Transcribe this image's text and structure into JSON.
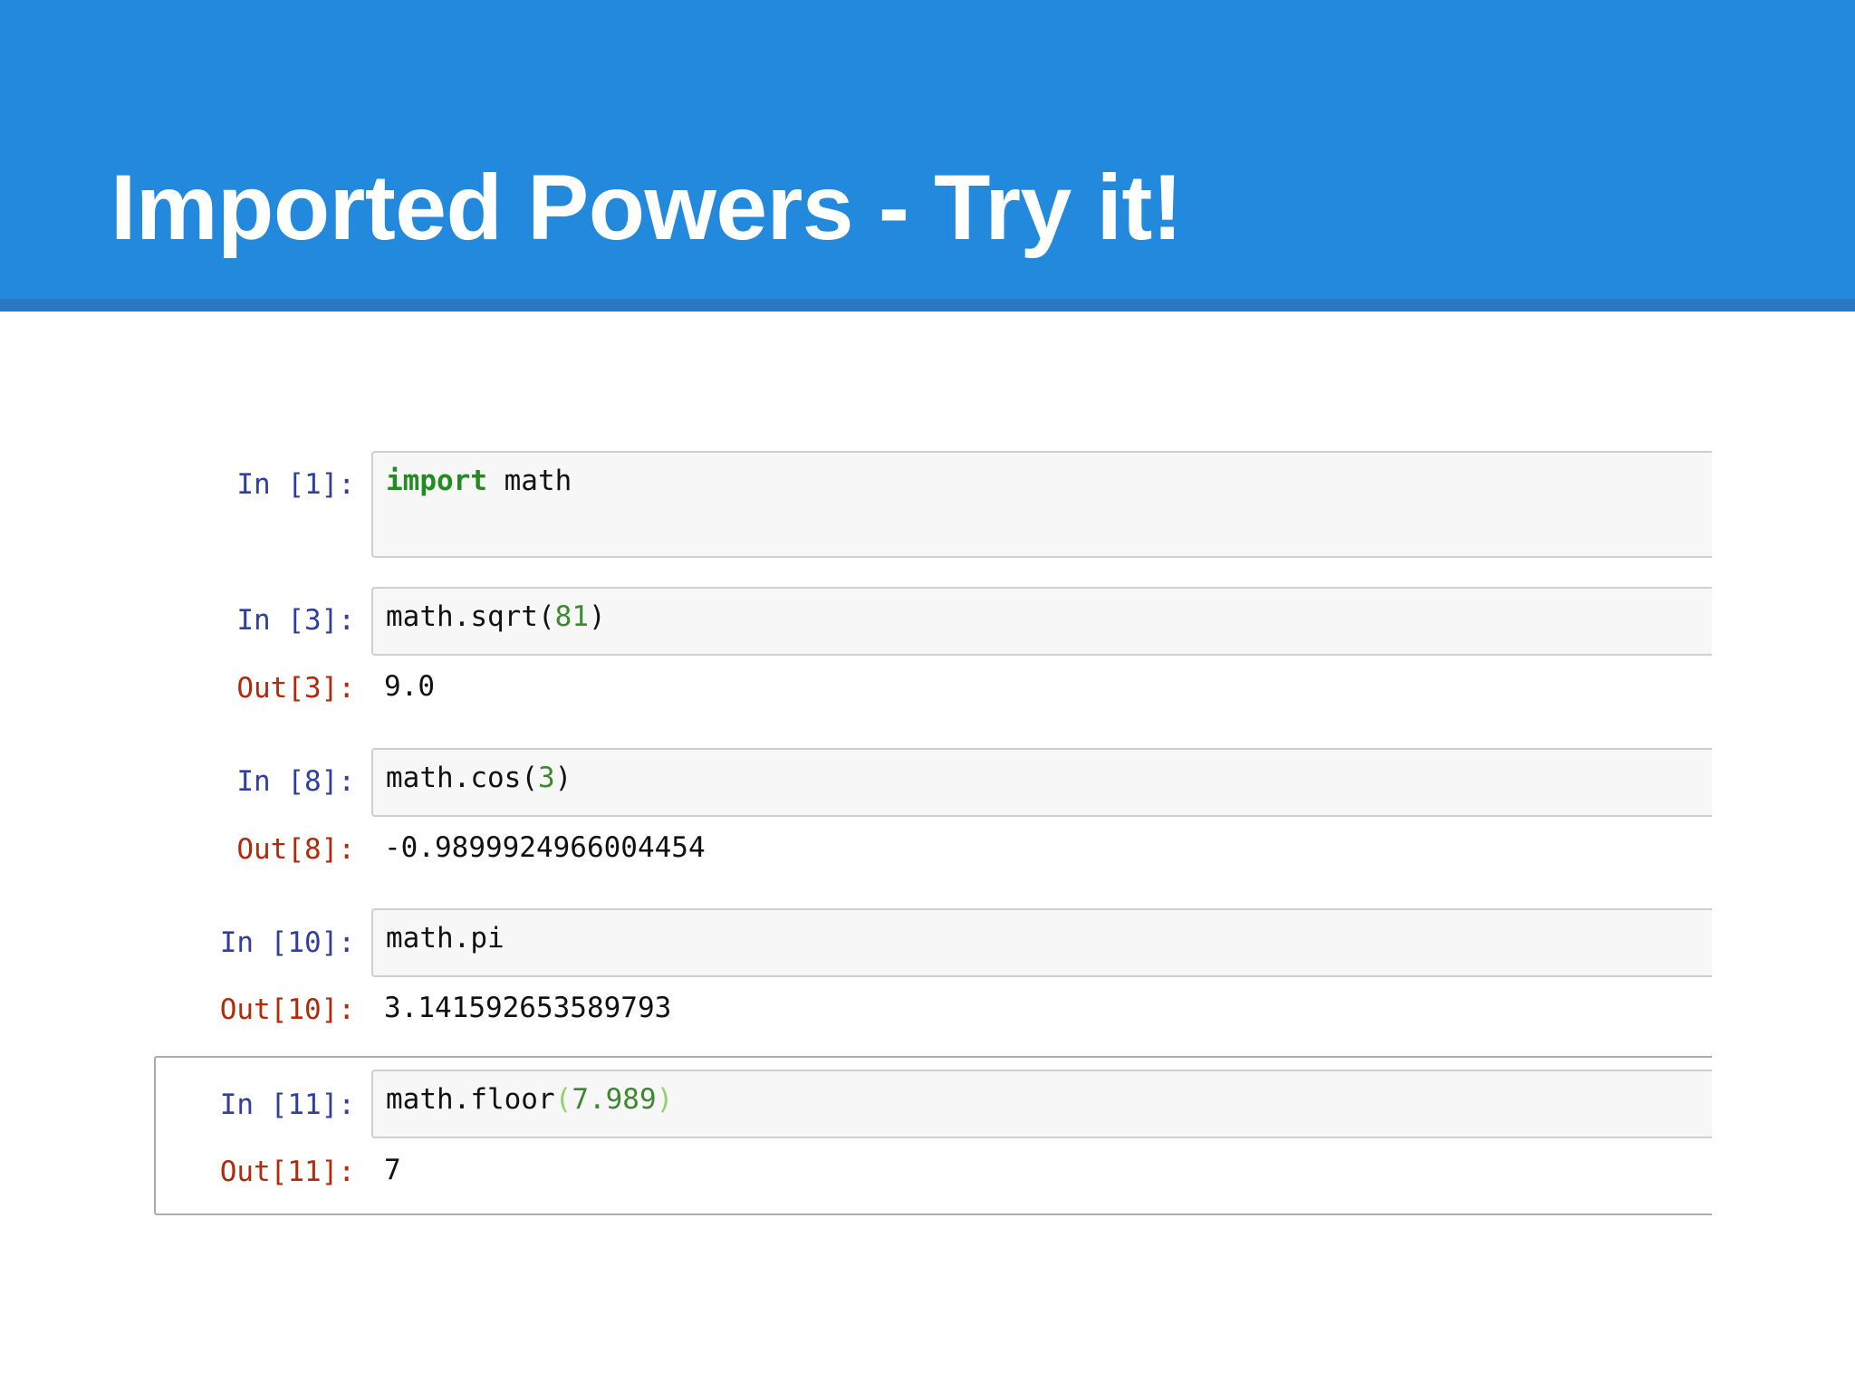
{
  "slide": {
    "title": "Imported Powers - Try it!"
  },
  "colors": {
    "header_bg": "#2389dc",
    "header_rule": "#2b78c2",
    "title_text": "#ffffff",
    "in_prompt": "#303f9f",
    "out_prompt": "#b22a0a",
    "keyword": "#228b22",
    "number_literal": "#3c8a2e",
    "matched_paren": "#8fd46a",
    "input_bg": "#f7f7f7",
    "input_border": "#cfcfcf"
  },
  "notebook": {
    "cells": [
      {
        "in_prompt": "In [1]:",
        "code": {
          "keyword": "import",
          "rest": " math"
        }
      },
      {
        "in_prompt": "In [3]:",
        "code": {
          "func": "math.sqrt",
          "open": "(",
          "arg": "81",
          "close": ")"
        },
        "out_prompt": "Out[3]:",
        "output": "9.0"
      },
      {
        "in_prompt": "In [8]:",
        "code": {
          "func": "math.cos",
          "open": "(",
          "arg": "3",
          "close": ")"
        },
        "out_prompt": "Out[8]:",
        "output": "-0.9899924966004454"
      },
      {
        "in_prompt": "In [10]:",
        "code": {
          "text": "math.pi"
        },
        "out_prompt": "Out[10]:",
        "output": "3.141592653589793"
      },
      {
        "in_prompt": "In [11]:",
        "code": {
          "func": "math.floor",
          "open": "(",
          "arg": "7.989",
          "close": ")"
        },
        "out_prompt": "Out[11]:",
        "output": "7",
        "selected": true
      }
    ]
  }
}
